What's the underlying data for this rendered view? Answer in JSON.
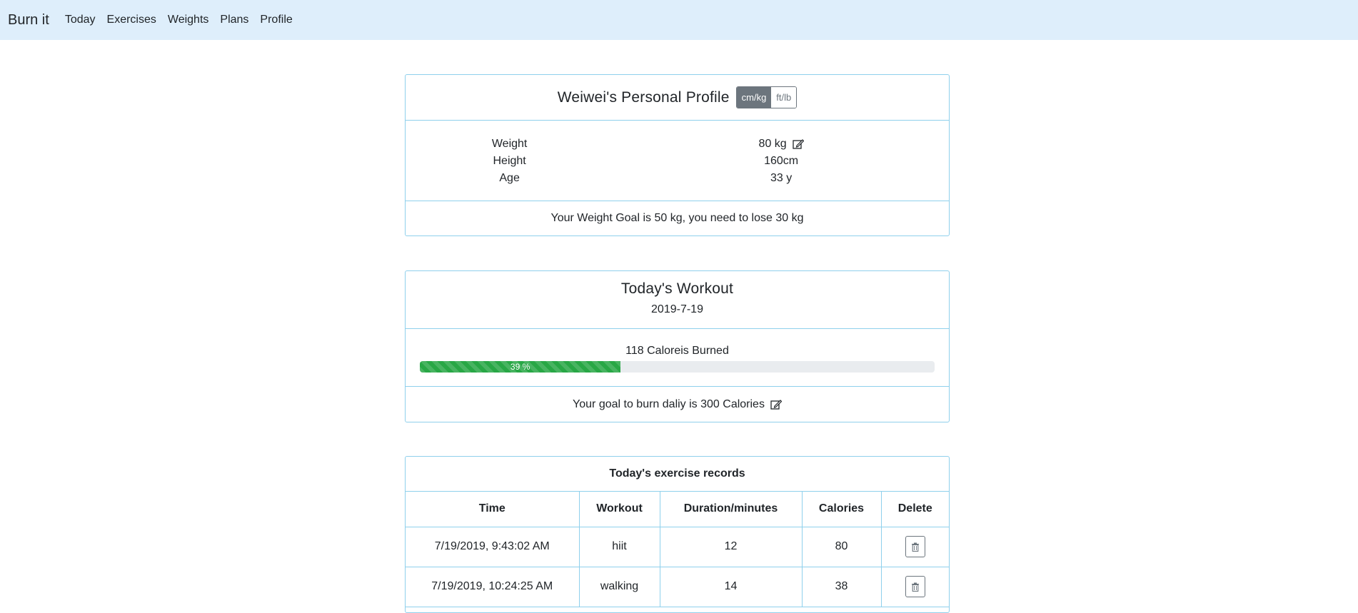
{
  "nav": {
    "brand": "Burn it",
    "links": [
      "Today",
      "Exercises",
      "Weights",
      "Plans",
      "Profile"
    ]
  },
  "profile": {
    "title": "Weiwei's Personal Profile",
    "units": {
      "active": "cm/kg",
      "inactive": "ft/lb"
    },
    "stats": [
      {
        "label": "Weight",
        "value": "80 kg"
      },
      {
        "label": "Height",
        "value": "160cm"
      },
      {
        "label": "Age",
        "value": "33 y"
      }
    ],
    "goal_text": "Your Weight Goal is 50 kg, you need to lose 30 kg"
  },
  "workout": {
    "title": "Today's Workout",
    "date": "2019-7-19",
    "burned_text": "118 Caloreis Burned",
    "progress_percent": 39,
    "progress_label": "39 %",
    "daily_goal_text": "Your goal to burn daliy is 300 Calories"
  },
  "records": {
    "title": "Today's exercise records",
    "columns": [
      "Time",
      "Workout",
      "Duration/minutes",
      "Calories",
      "Delete"
    ],
    "rows": [
      {
        "time": "7/19/2019, 9:43:02 AM",
        "workout": "hiit",
        "duration": "12",
        "calories": "80"
      },
      {
        "time": "7/19/2019, 10:24:25 AM",
        "workout": "walking",
        "duration": "14",
        "calories": "38"
      }
    ]
  },
  "colors": {
    "navbar_bg": "#deeefb",
    "card_border": "#8fd0ec",
    "progress_fill": "#28a745",
    "toggle_active": "#6c757d"
  },
  "icons": {
    "edit": "edit-icon",
    "delete": "trash-icon"
  }
}
